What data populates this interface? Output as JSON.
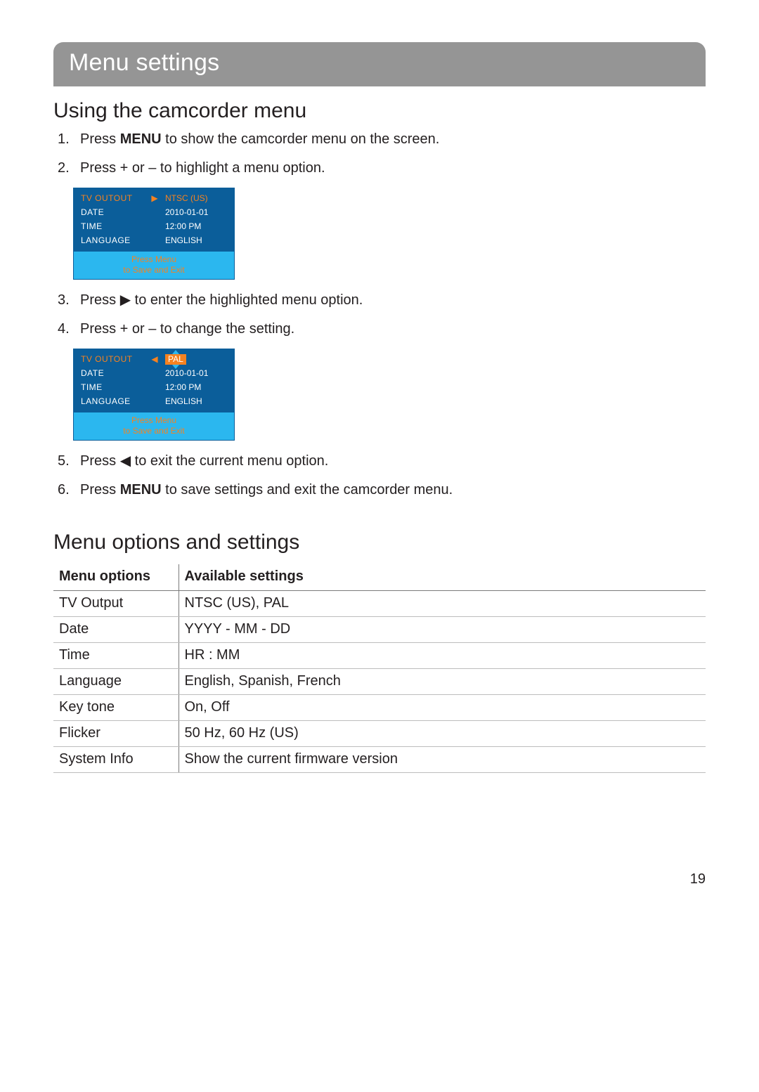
{
  "banner": {
    "title": "Menu settings"
  },
  "section1": {
    "heading": "Using the camcorder menu",
    "steps": [
      {
        "n": "1.",
        "pre": "Press ",
        "bold": "MENU",
        "post": " to show the camcorder menu on the screen."
      },
      {
        "n": "2.",
        "text": "Press + or – to highlight a menu option."
      },
      {
        "n": "3.",
        "pre": "Press ",
        "sym": "▶",
        "post": " to enter the highlighted menu option."
      },
      {
        "n": "4.",
        "text": "Press + or – to change the setting."
      },
      {
        "n": "5.",
        "pre": "Press ",
        "sym": "◀",
        "post": " to exit the current menu option."
      },
      {
        "n": "6.",
        "pre": "Press ",
        "bold": "MENU",
        "post": " to save settings and exit the camcorder menu."
      }
    ]
  },
  "menuA": {
    "rows": [
      {
        "label": "TV OUTOUT",
        "arrow": "▶",
        "value": "NTSC (US)",
        "selected": true
      },
      {
        "label": "DATE",
        "value": "2010-01-01"
      },
      {
        "label": "TIME",
        "value": "12:00 PM"
      },
      {
        "label": "LANGUAGE",
        "value": "ENGLISH"
      }
    ],
    "footer1": "Press Menu",
    "footer2": "to Save and Exit"
  },
  "menuB": {
    "rows": [
      {
        "label": "TV OUTOUT",
        "arrow": "◀",
        "value": "PAL",
        "selected": true,
        "valueHighlighted": true
      },
      {
        "label": "DATE",
        "value": "2010-01-01"
      },
      {
        "label": "TIME",
        "value": "12:00 PM"
      },
      {
        "label": "LANGUAGE",
        "value": "ENGLISH"
      }
    ],
    "footer1": "Press Menu",
    "footer2": "to Save and Exit"
  },
  "section2": {
    "heading": "Menu options and settings",
    "th1": "Menu options",
    "th2": "Available settings",
    "rows": [
      {
        "opt": "TV Output",
        "val": "NTSC (US), PAL"
      },
      {
        "opt": "Date",
        "val": "YYYY - MM - DD"
      },
      {
        "opt": "Time",
        "val": "HR : MM"
      },
      {
        "opt": "Language",
        "val": "English, Spanish, French"
      },
      {
        "opt": "Key tone",
        "val": "On, Off"
      },
      {
        "opt": "Flicker",
        "val": "50 Hz, 60 Hz  (US)"
      },
      {
        "opt": "System Info",
        "val": "Show the current firmware version"
      }
    ]
  },
  "pageNumber": "19"
}
